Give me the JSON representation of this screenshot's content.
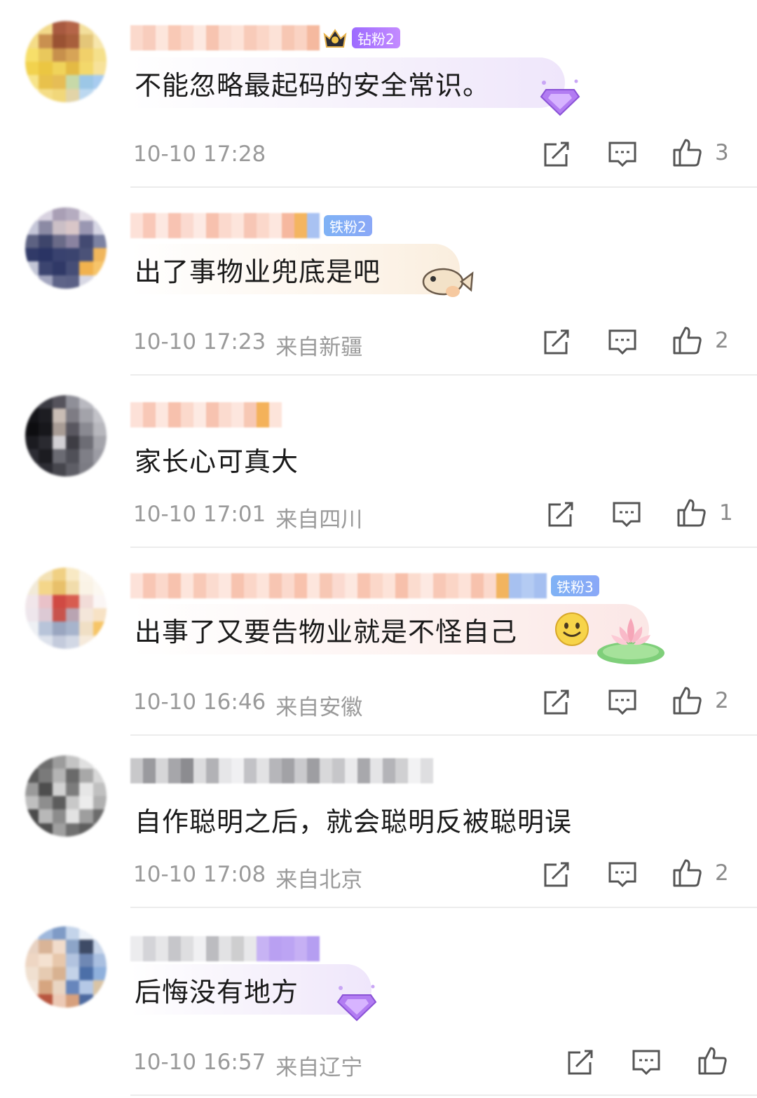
{
  "comments": [
    {
      "badge": "钻粉2",
      "text": "不能忽略最起码的安全常识。",
      "time": "10-10 17:28",
      "location": "",
      "likes": "3",
      "icons": {
        "share": "share-icon",
        "reply": "comment-icon",
        "like": "thumbs-up-icon"
      }
    },
    {
      "badge": "铁粉2",
      "text": "出了事物业兜底是吧",
      "time": "10-10 17:23",
      "location": "来自新疆",
      "likes": "2"
    },
    {
      "badge": "",
      "text": "家长心可真大",
      "time": "10-10 17:01",
      "location": "来自四川",
      "likes": "1"
    },
    {
      "badge": "铁粉3",
      "text": "出事了又要告物业就是不怪自己",
      "time": "10-10 16:46",
      "location": "来自安徽",
      "likes": "2"
    },
    {
      "badge": "",
      "text": "自作聪明之后，就会聪明反被聪明误",
      "time": "10-10 17:08",
      "location": "来自北京",
      "likes": "2"
    },
    {
      "badge": "",
      "text": "后悔没有地方",
      "time": "10-10 16:57",
      "location": "来自辽宁",
      "likes": ""
    }
  ],
  "colors": {
    "diamond_badge": "#a872ff",
    "iron_badge": "#7fa9f5",
    "meta_text": "#9a9a9a",
    "divider": "#ececec"
  }
}
